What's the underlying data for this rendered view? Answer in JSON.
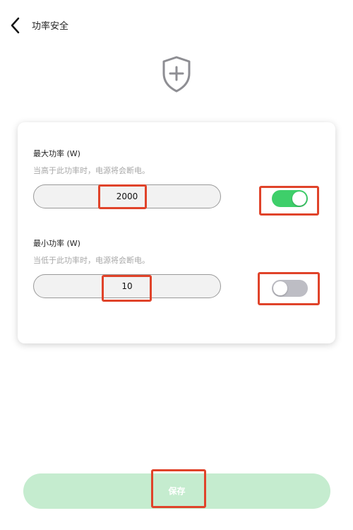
{
  "header": {
    "title": "功率安全",
    "back_icon": "chevron-left-icon"
  },
  "hero": {
    "icon": "shield-plus-icon",
    "color": "#8e8e93"
  },
  "settings": {
    "max_power": {
      "title": "最大功率 (W)",
      "hint": "当高于此功率时，电源将会断电。",
      "value": "2000",
      "enabled": true
    },
    "min_power": {
      "title": "最小功率 (W)",
      "hint": "当低于此功率时，电源将会断电。",
      "value": "10",
      "enabled": false
    }
  },
  "footer": {
    "save_label": "保存"
  },
  "colors": {
    "toggle_on": "#3ecf6a",
    "toggle_off": "#bdbdc4",
    "save_button": "#c5eccf",
    "highlight": "#e0432a"
  }
}
